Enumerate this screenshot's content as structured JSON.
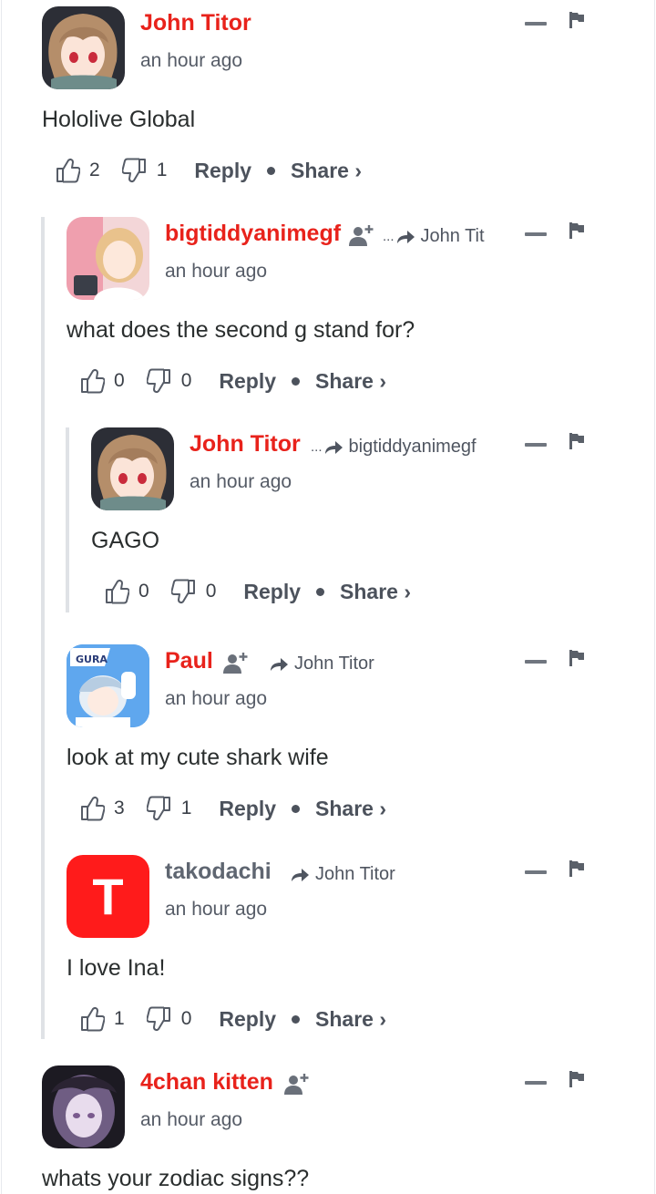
{
  "thread": {
    "comments": [
      {
        "author": "John Titor",
        "time": "an hour ago",
        "text": "Hololive Global",
        "upvotes": "2",
        "downvotes": "1",
        "reply_label": "Reply",
        "share_label": "Share ›"
      },
      {
        "author": "bigtiddyanimegf",
        "parent_prefix": "...",
        "parent": "John Tit",
        "time": "an hour ago",
        "text": "what does the second g stand for?",
        "upvotes": "0",
        "downvotes": "0",
        "reply_label": "Reply",
        "share_label": "Share ›"
      },
      {
        "author": "John Titor",
        "parent_prefix": "...",
        "parent": "bigtiddyanimegf",
        "time": "an hour ago",
        "text": "GAGO",
        "upvotes": "0",
        "downvotes": "0",
        "reply_label": "Reply",
        "share_label": "Share ›"
      },
      {
        "author": "Paul",
        "parent": "John Titor",
        "time": "an hour ago",
        "text": "look at my cute shark wife",
        "upvotes": "3",
        "downvotes": "1",
        "reply_label": "Reply",
        "share_label": "Share ›",
        "avatar_text": "GURA"
      },
      {
        "author": "takodachi",
        "parent": "John Titor",
        "time": "an hour ago",
        "text": "I love Ina!",
        "upvotes": "1",
        "downvotes": "0",
        "reply_label": "Reply",
        "share_label": "Share ›",
        "avatar_letter": "T"
      },
      {
        "author": "4chan kitten",
        "time": "an hour ago",
        "text": "whats your zodiac signs??"
      }
    ]
  },
  "icons": {
    "upvote": "thumbs-up-icon",
    "downvote": "thumbs-down-icon",
    "collapse": "minus-icon",
    "flag": "flag-icon",
    "follow": "add-user-icon",
    "reply_to": "reply-arrow-icon"
  },
  "colors": {
    "author": "#e8221b",
    "author_muted": "#5f6671",
    "thread_line": "#dfe2e6",
    "takodachi_avatar": "#ff1b1b"
  }
}
